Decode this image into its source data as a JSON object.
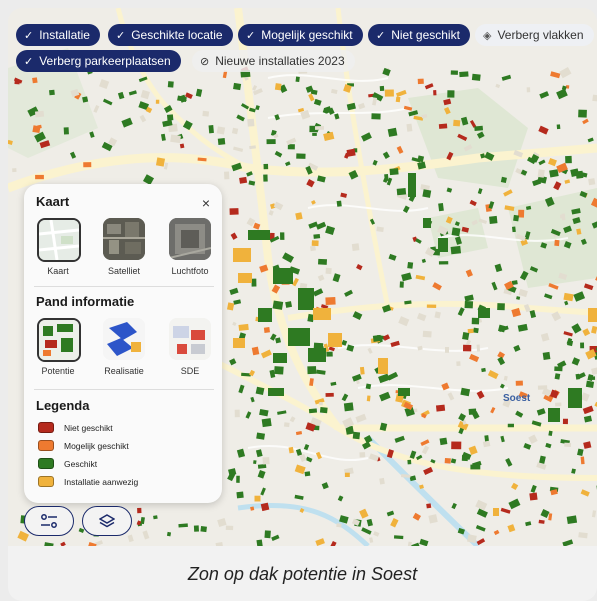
{
  "filters": [
    {
      "label": "Installatie",
      "checked": true
    },
    {
      "label": "Geschikte locatie",
      "checked": true
    },
    {
      "label": "Mogelijk geschikt",
      "checked": true
    },
    {
      "label": "Niet geschikt",
      "checked": true
    },
    {
      "label": "Verberg vlakken",
      "checked": false
    },
    {
      "label": "Verberg parkeerplaatsen",
      "checked": true
    },
    {
      "label": "Nieuwe installaties 2023",
      "checked": false
    }
  ],
  "panel": {
    "kaart_title": "Kaart",
    "close": "×",
    "map_types": [
      "Kaart",
      "Satelliet",
      "Luchtfoto"
    ],
    "pand_title": "Pand informatie",
    "pand_types": [
      "Potentie",
      "Realisatie",
      "SDE"
    ],
    "legend_title": "Legenda",
    "legend": [
      {
        "label": "Niet geschikt",
        "color": "#b52a1d"
      },
      {
        "label": "Mogelijk geschikt",
        "color": "#ee7a30"
      },
      {
        "label": "Geschikt",
        "color": "#2e7a22"
      },
      {
        "label": "Installatie aanwezig",
        "color": "#f0b23c"
      }
    ]
  },
  "map": {
    "place_label": "Soest"
  },
  "caption": "Zon op dak potentie in Soest",
  "colors": {
    "chip": "#1b2a6b",
    "geschikt": "#2e7a22",
    "installatie": "#f0b23c",
    "road": "#fbf5d8"
  }
}
